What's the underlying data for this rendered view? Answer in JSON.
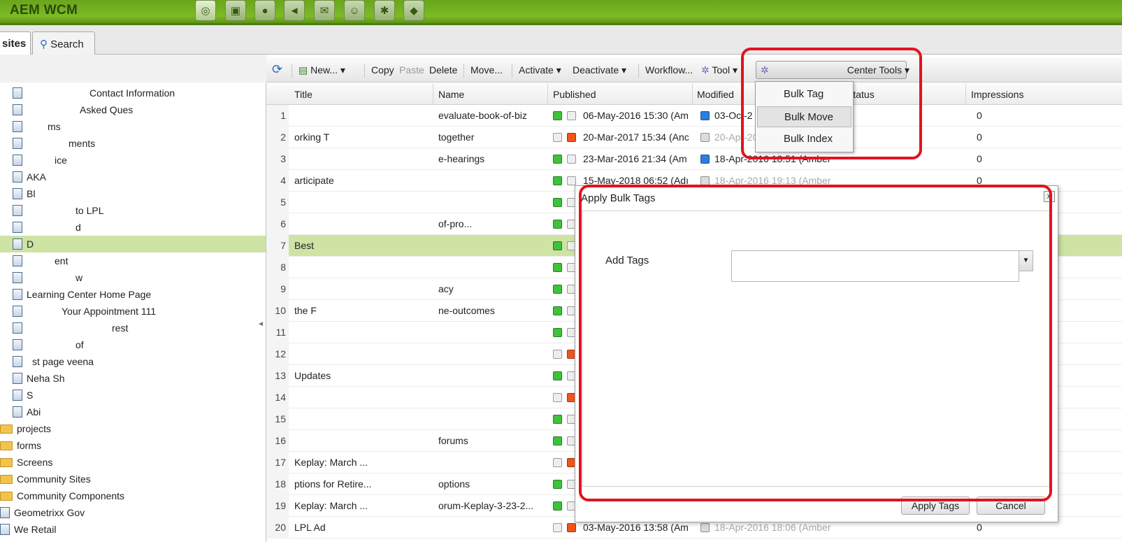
{
  "app": {
    "title": "AEM WCM"
  },
  "nav_icons": [
    "globe-icon",
    "camera-icon",
    "chat-icon",
    "megaphone-icon",
    "mail-icon",
    "users-icon",
    "gear-icon",
    "tag-icon"
  ],
  "tabs": [
    {
      "label": "sites"
    },
    {
      "label": "Search"
    }
  ],
  "tree": {
    "items": [
      {
        "label": "Contact Information",
        "type": "page"
      },
      {
        "label": "Asked Ques",
        "type": "page"
      },
      {
        "label": "ms",
        "type": "page"
      },
      {
        "label": "ments",
        "type": "page"
      },
      {
        "label": "ice",
        "type": "page"
      },
      {
        "label": "AKA",
        "type": "page"
      },
      {
        "label": "Bl",
        "type": "page"
      },
      {
        "label": "to LPL",
        "type": "page"
      },
      {
        "label": "d",
        "type": "page",
        "selected": false
      },
      {
        "label": "D",
        "type": "page",
        "selected": true
      },
      {
        "label": "ent",
        "type": "page"
      },
      {
        "label": "w",
        "type": "page"
      },
      {
        "label": "Learning Center Home Page",
        "type": "page"
      },
      {
        "label": "Your Appointment 111",
        "type": "page"
      },
      {
        "label": "rest",
        "type": "page"
      },
      {
        "label": "of",
        "type": "page"
      },
      {
        "label": "st page veena",
        "type": "page"
      },
      {
        "label": "Neha Sh",
        "type": "page"
      },
      {
        "label": "S",
        "type": "page"
      },
      {
        "label": "Abi",
        "type": "page"
      },
      {
        "label": "projects",
        "type": "folder"
      },
      {
        "label": "forms",
        "type": "folder"
      },
      {
        "label": "Screens",
        "type": "folder"
      },
      {
        "label": "Community Sites",
        "type": "folder"
      },
      {
        "label": "Community Components",
        "type": "folder"
      },
      {
        "label": "Geometrixx Gov",
        "type": "page"
      },
      {
        "label": "We Retail",
        "type": "page"
      }
    ]
  },
  "toolbar": {
    "refresh": "refresh-icon",
    "new": "New...",
    "copy": "Copy",
    "paste": "Paste",
    "delete": "Delete",
    "move": "Move...",
    "activate": "Activate",
    "deactivate": "Deactivate",
    "workflow": "Workflow...",
    "tools": "Tool",
    "center_tools": "Center Tools"
  },
  "grid": {
    "columns": {
      "title": "Title",
      "name": "Name",
      "published": "Published",
      "modified": "Modified",
      "status": "Status",
      "impressions": "Impressions"
    },
    "rows": [
      {
        "n": "1",
        "title": "",
        "name": "evaluate-book-of-biz",
        "pub_a": "green",
        "pub_b": "none",
        "published": "06-May-2016 15:30 (Am",
        "mod_icon": "blue",
        "modified": "03-Oct-2",
        "impressions": "0",
        "selected": false
      },
      {
        "n": "2",
        "title": "orking T",
        "name": "together",
        "pub_a": "none",
        "pub_b": "orange",
        "published": "20-Mar-2017 15:34 (Anc",
        "mod_icon": "grey",
        "modified": "20-Apr-20",
        "impressions": "0",
        "selected": false
      },
      {
        "n": "3",
        "title": "",
        "name": "e-hearings",
        "pub_a": "green",
        "pub_b": "none",
        "published": "23-Mar-2016 21:34 (Am",
        "mod_icon": "blue",
        "modified": "18-Apr-2016 18:51 (Amber",
        "impressions": "0",
        "selected": false
      },
      {
        "n": "4",
        "title": "articipate",
        "name": "",
        "pub_a": "green",
        "pub_b": "none",
        "published": "15-May-2018 06:52 (Adı",
        "mod_icon": "grey",
        "modified": "18-Apr-2016 19:13 (Amber",
        "impressions": "0",
        "selected": false
      },
      {
        "n": "5",
        "title": "",
        "name": "",
        "pub_a": "green",
        "pub_b": "none",
        "published": "",
        "mod_icon": "none",
        "modified": "",
        "impressions": "",
        "selected": false
      },
      {
        "n": "6",
        "title": "",
        "name": "of-pro...",
        "pub_a": "green",
        "pub_b": "none",
        "published": "",
        "mod_icon": "none",
        "modified": "",
        "impressions": "",
        "selected": false
      },
      {
        "n": "7",
        "title": "Best",
        "name": "",
        "pub_a": "green",
        "pub_b": "none",
        "published": "",
        "mod_icon": "none",
        "modified": "",
        "impressions": "",
        "selected": true
      },
      {
        "n": "8",
        "title": "",
        "name": "",
        "pub_a": "green",
        "pub_b": "none",
        "published": "",
        "mod_icon": "none",
        "modified": "",
        "impressions": "",
        "selected": false
      },
      {
        "n": "9",
        "title": "",
        "name": "acy",
        "pub_a": "green",
        "pub_b": "none",
        "published": "",
        "mod_icon": "none",
        "modified": "",
        "impressions": "",
        "selected": false
      },
      {
        "n": "10",
        "title": "the F",
        "name": "ne-outcomes",
        "pub_a": "green",
        "pub_b": "none",
        "published": "",
        "mod_icon": "none",
        "modified": "",
        "impressions": "",
        "selected": false
      },
      {
        "n": "11",
        "title": "",
        "name": "",
        "pub_a": "green",
        "pub_b": "none",
        "published": "",
        "mod_icon": "none",
        "modified": "",
        "impressions": "",
        "selected": false
      },
      {
        "n": "12",
        "title": "",
        "name": "",
        "pub_a": "none",
        "pub_b": "orange",
        "published": "",
        "mod_icon": "none",
        "modified": "",
        "impressions": "",
        "selected": false
      },
      {
        "n": "13",
        "title": "Updates",
        "name": "",
        "pub_a": "green",
        "pub_b": "none",
        "published": "",
        "mod_icon": "none",
        "modified": "",
        "impressions": "",
        "selected": false
      },
      {
        "n": "14",
        "title": "",
        "name": "",
        "pub_a": "none",
        "pub_b": "orange",
        "published": "",
        "mod_icon": "none",
        "modified": "",
        "impressions": "",
        "selected": false
      },
      {
        "n": "15",
        "title": "",
        "name": "",
        "pub_a": "green",
        "pub_b": "none",
        "published": "",
        "mod_icon": "none",
        "modified": "",
        "impressions": "",
        "selected": false
      },
      {
        "n": "16",
        "title": "",
        "name": "forums",
        "pub_a": "green",
        "pub_b": "none",
        "published": "",
        "mod_icon": "none",
        "modified": "",
        "impressions": "",
        "selected": false
      },
      {
        "n": "17",
        "title": "Keplay: March ...",
        "name": "",
        "pub_a": "none",
        "pub_b": "orange",
        "published": "",
        "mod_icon": "none",
        "modified": "",
        "impressions": "",
        "selected": false
      },
      {
        "n": "18",
        "title": "ptions for Retire...",
        "name": "options",
        "pub_a": "green",
        "pub_b": "none",
        "published": "",
        "mod_icon": "none",
        "modified": "",
        "impressions": "",
        "selected": false
      },
      {
        "n": "19",
        "title": "Keplay: March ...",
        "name": "orum-Keplay-3-23-2...",
        "pub_a": "green",
        "pub_b": "none",
        "published": "",
        "mod_icon": "none",
        "modified": "",
        "impressions": "",
        "selected": false
      },
      {
        "n": "20",
        "title": "LPL Ad",
        "name": "",
        "pub_a": "none",
        "pub_b": "orange",
        "published": "03-May-2016 13:58 (Am",
        "mod_icon": "grey",
        "modified": "18-Apr-2016 18:06 (Amber",
        "impressions": "0",
        "selected": false
      }
    ]
  },
  "dropdown": {
    "items": [
      {
        "label": "Bulk Tag"
      },
      {
        "label": "Bulk Move"
      },
      {
        "label": "Bulk Index"
      }
    ]
  },
  "dialog": {
    "title": "Apply Bulk Tags",
    "close": "×",
    "add_tags_label": "Add Tags",
    "tags_value": "",
    "apply_button": "Apply Tags",
    "cancel_button": "Cancel"
  },
  "colors": {
    "brand_green": "#7bbb24",
    "selection_green": "#cfe3a5",
    "highlight_red": "#e0141f",
    "status_green": "#3ec23a",
    "status_orange": "#f2541b",
    "status_blue": "#2a7fde"
  }
}
